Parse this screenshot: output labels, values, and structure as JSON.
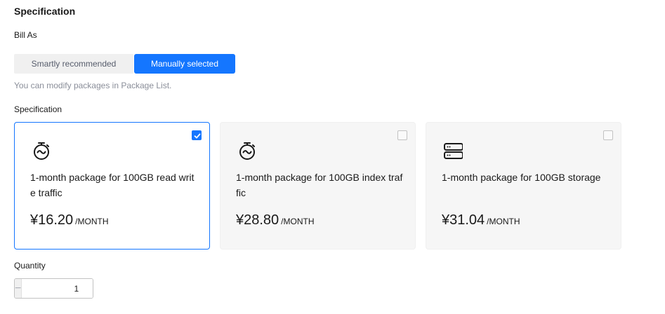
{
  "section": {
    "title": "Specification"
  },
  "bill_as": {
    "label": "Bill As",
    "options": [
      "Smartly recommended",
      "Manually selected"
    ],
    "selected": "Manually selected",
    "hint": "You can modify packages in Package List."
  },
  "specification": {
    "label": "Specification",
    "cards": [
      {
        "icon": "stopwatch-icon",
        "description": "1-month package for 100GB read write traffic",
        "price": "¥16.20",
        "unit": "/MONTH",
        "selected": true
      },
      {
        "icon": "stopwatch-icon",
        "description": "1-month package for 100GB index traffic",
        "price": "¥28.80",
        "unit": "/MONTH",
        "selected": false
      },
      {
        "icon": "storage-server-icon",
        "description": "1-month package for 100GB storage",
        "price": "¥31.04",
        "unit": "/MONTH",
        "selected": false
      }
    ]
  },
  "quantity": {
    "label": "Quantity",
    "value": "1",
    "minus": "−",
    "plus": "+"
  },
  "colors": {
    "accent": "#1476ff",
    "muted": "#8a8e99",
    "card_bg": "#f6f6f6"
  }
}
